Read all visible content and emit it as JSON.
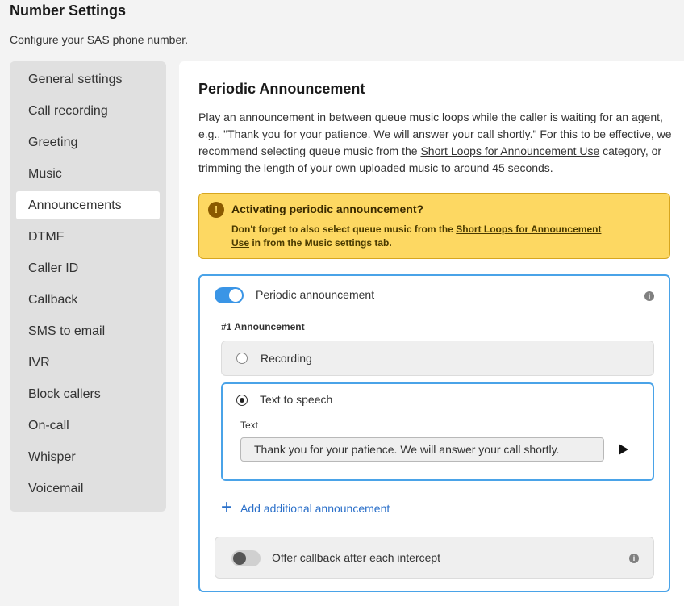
{
  "page": {
    "title": "Number Settings",
    "subtitle": "Configure your SAS phone number."
  },
  "sidebar": {
    "items": [
      {
        "label": "General settings"
      },
      {
        "label": "Call recording"
      },
      {
        "label": "Greeting"
      },
      {
        "label": "Music"
      },
      {
        "label": "Announcements",
        "active": true
      },
      {
        "label": "DTMF"
      },
      {
        "label": "Caller ID"
      },
      {
        "label": "Callback"
      },
      {
        "label": "SMS to email"
      },
      {
        "label": "IVR"
      },
      {
        "label": "Block callers"
      },
      {
        "label": "On-call"
      },
      {
        "label": "Whisper"
      },
      {
        "label": "Voicemail"
      }
    ]
  },
  "main": {
    "title": "Periodic Announcement",
    "desc_before": "Play an announcement in between queue music loops while the caller is waiting for an agent, e.g., \"Thank you for your patience. We will answer your call shortly.\" For this to be effective, we recommend selecting queue music from the ",
    "desc_link": "Short Loops for Announcement Use",
    "desc_after": " category, or trimming the length of your own uploaded music to around 45 seconds."
  },
  "alert": {
    "icon": "exclamation-icon",
    "title": "Activating periodic announcement?",
    "body_before": "Don't forget to also select queue music from the ",
    "body_link": "Short Loops for Announcement Use",
    "body_after": " in from the Music settings tab.",
    "color": "#fdd862"
  },
  "card": {
    "toggle_label": "Periodic announcement",
    "toggle_on": true,
    "announcement_label": "#1 Announcement",
    "option_recording": "Recording",
    "option_tts": "Text to speech",
    "selected_option": "Text to speech",
    "text_label": "Text",
    "text_value": "Thank you for your patience. We will answer your call shortly.",
    "add_label": "Add additional announcement",
    "callback_label": "Offer callback after each intercept",
    "callback_on": false,
    "accent": "#4aa3e8"
  }
}
